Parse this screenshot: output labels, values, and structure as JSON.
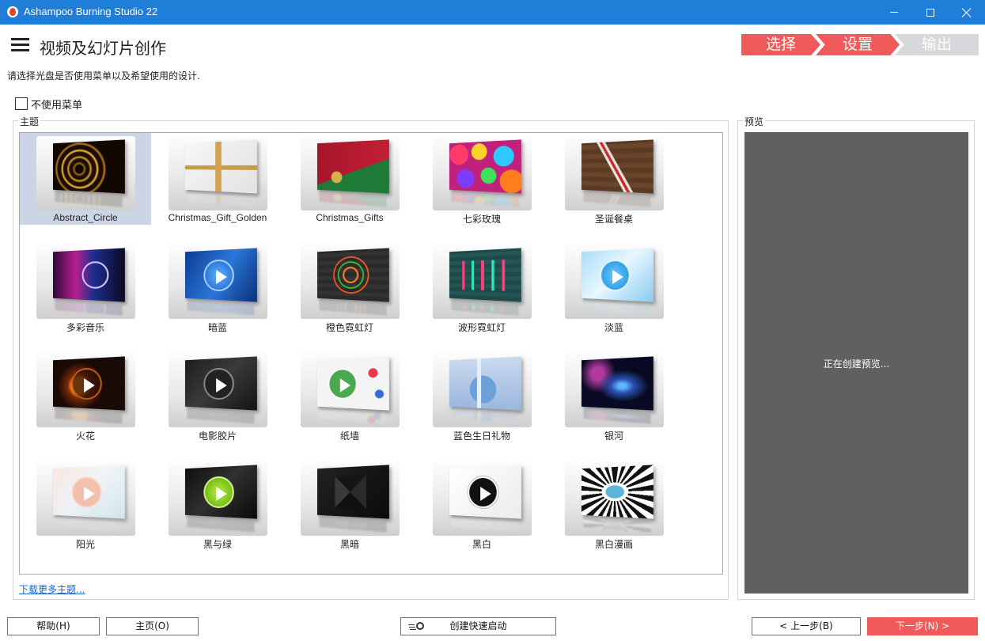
{
  "window": {
    "title": "Ashampoo Burning Studio 22"
  },
  "header": {
    "title": "视频及幻灯片创作",
    "subtitle": "请选择光盘是否使用菜单以及希望使用的设计."
  },
  "steps": [
    "选择",
    "设置",
    "输出"
  ],
  "no_menu_checkbox": {
    "label": "不使用菜单",
    "checked": false
  },
  "themes": {
    "legend": "主题",
    "selected": "Abstract_Circle",
    "items": [
      {
        "label": "Abstract_Circle",
        "icon": "golden-rings-image"
      },
      {
        "label": "Christmas_Gift_Golden",
        "icon": "golden-ribbon-gift-image"
      },
      {
        "label": "Christmas_Gifts",
        "icon": "red-green-gifts-image"
      },
      {
        "label": "七彩玫瑰",
        "icon": "rainbow-roses-image"
      },
      {
        "label": "圣诞餐桌",
        "icon": "christmas-table-image"
      },
      {
        "label": "多彩音乐",
        "icon": "colorful-music-image"
      },
      {
        "label": "暗蓝",
        "icon": "dark-blue-play-image"
      },
      {
        "label": "橙色霓虹灯",
        "icon": "orange-neon-image"
      },
      {
        "label": "波形霓虹灯",
        "icon": "waveform-neon-image"
      },
      {
        "label": "淡蓝",
        "icon": "light-blue-play-image"
      },
      {
        "label": "火花",
        "icon": "sparks-play-image"
      },
      {
        "label": "电影胶片",
        "icon": "film-play-image"
      },
      {
        "label": "纸墙",
        "icon": "paper-wall-play-image"
      },
      {
        "label": "蓝色生日礼物",
        "icon": "blue-birthday-gift-image"
      },
      {
        "label": "银河",
        "icon": "galaxy-image"
      },
      {
        "label": "阳光",
        "icon": "sunshine-play-image"
      },
      {
        "label": "黑与绿",
        "icon": "black-green-play-image"
      },
      {
        "label": "黑暗",
        "icon": "dark-diamond-image"
      },
      {
        "label": "黑白",
        "icon": "black-white-play-image"
      },
      {
        "label": "黑白漫画",
        "icon": "pow-comic-image"
      }
    ]
  },
  "download_link": "下载更多主题...",
  "preview": {
    "legend": "预览",
    "status": "正在创建预览..."
  },
  "buttons": {
    "help": "帮助(H)",
    "home": "主页(O)",
    "quick_start": "创建快速启动",
    "prev": "< 上一步(B)",
    "next": "下一步(N) >"
  },
  "colors": {
    "titlebar": "#1f7ed8",
    "accent": "#f15a5a",
    "step_inactive": "#d7d7dc",
    "preview_bg": "#606060",
    "selection": "#ccd5e6"
  }
}
